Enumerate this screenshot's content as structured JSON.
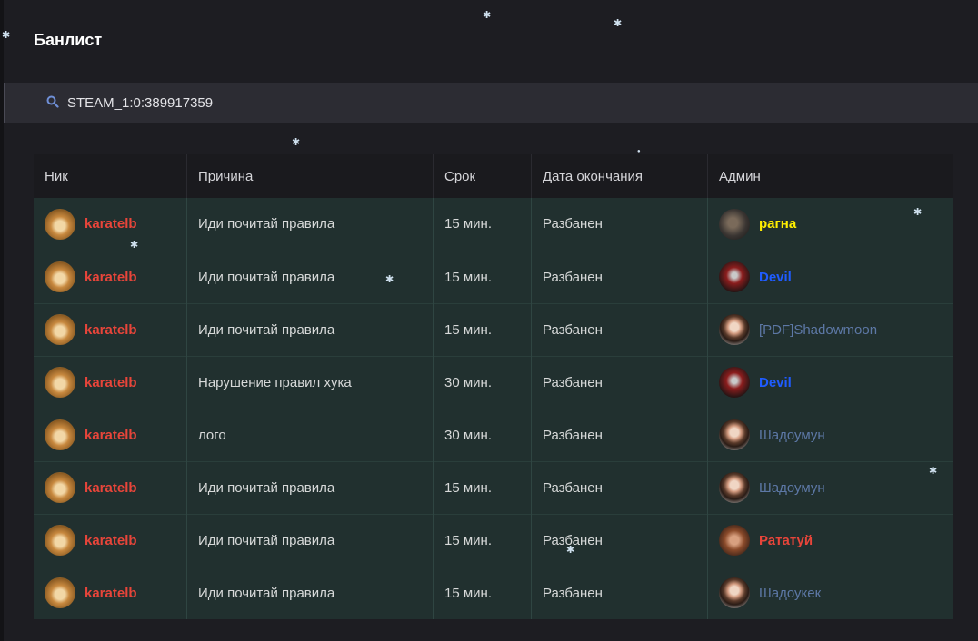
{
  "page": {
    "title": "Банлист"
  },
  "search": {
    "value": "STEAM_1:0:389917359",
    "icon": "search-icon"
  },
  "table": {
    "headers": [
      "Ник",
      "Причина",
      "Срок",
      "Дата окончания",
      "Админ"
    ],
    "rows": [
      {
        "nick": "karatelb",
        "reason": "Иди почитай правила",
        "term": "15 мин.",
        "end": "Разбанен",
        "admin": "рагна",
        "admin_style": "yellow",
        "admin_avatar": "dark"
      },
      {
        "nick": "karatelb",
        "reason": "Иди почитай правила",
        "term": "15 мин.",
        "end": "Разбанен",
        "admin": "Devil",
        "admin_style": "blue",
        "admin_avatar": "devil"
      },
      {
        "nick": "karatelb",
        "reason": "Иди почитай правила",
        "term": "15 мин.",
        "end": "Разбанен",
        "admin": "[PDF]Shadowmoon",
        "admin_style": "muted",
        "admin_avatar": "face"
      },
      {
        "nick": "karatelb",
        "reason": "Нарушение правил хука",
        "term": "30 мин.",
        "end": "Разбанен",
        "admin": "Devil",
        "admin_style": "blue",
        "admin_avatar": "devil"
      },
      {
        "nick": "karatelb",
        "reason": "лого",
        "term": "30 мин.",
        "end": "Разбанен",
        "admin": "Шадоумун",
        "admin_style": "muted",
        "admin_avatar": "face"
      },
      {
        "nick": "karatelb",
        "reason": "Иди почитай правила",
        "term": "15 мин.",
        "end": "Разбанен",
        "admin": "Шадоумун",
        "admin_style": "muted",
        "admin_avatar": "face"
      },
      {
        "nick": "karatelb",
        "reason": "Иди почитай правила",
        "term": "15 мин.",
        "end": "Разбанен",
        "admin": "Рататуй",
        "admin_style": "red",
        "admin_avatar": "rat"
      },
      {
        "nick": "karatelb",
        "reason": "Иди почитай правила",
        "term": "15 мин.",
        "end": "Разбанен",
        "admin": "Шадоукек",
        "admin_style": "muted",
        "admin_avatar": "face"
      }
    ]
  },
  "colors": {
    "background": "#1d1d22",
    "row_bg": "#21302f",
    "nick": "#e8453a",
    "term": "#3ec27e",
    "admin_yellow": "#ffee00",
    "admin_blue": "#1f5cff",
    "admin_muted": "#5d78a6"
  }
}
